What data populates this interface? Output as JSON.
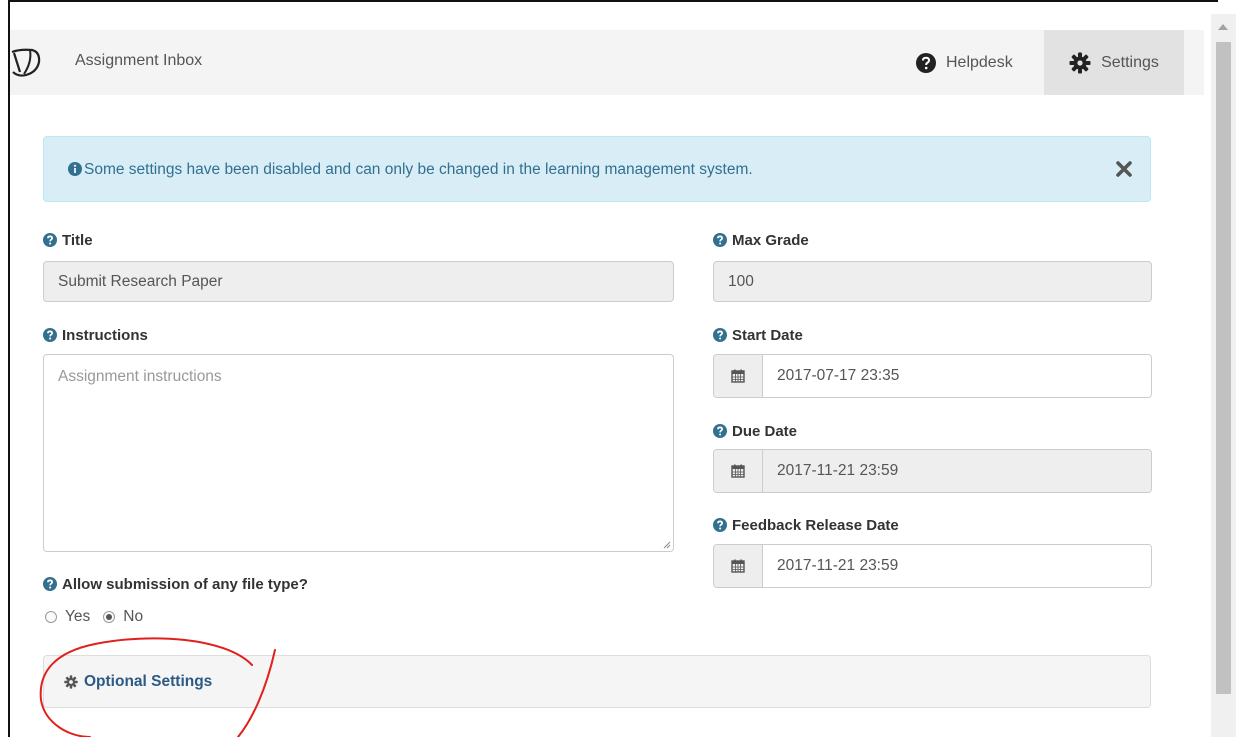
{
  "navbar": {
    "app_title": "Assignment Inbox",
    "helpdesk_label": "Helpdesk",
    "settings_label": "Settings"
  },
  "alert": {
    "message": "Some settings have been disabled and can only be changed in the learning management system."
  },
  "form": {
    "title_label": "Title",
    "title_value": "Submit Research Paper",
    "instructions_label": "Instructions",
    "instructions_placeholder": "Assignment instructions",
    "file_type_label": "Allow submission of any file type?",
    "file_type_options": [
      "Yes",
      "No"
    ],
    "file_type_selected": "No",
    "max_grade_label": "Max Grade",
    "max_grade_value": "100",
    "start_date_label": "Start Date",
    "start_date_value": "2017-07-17 23:35",
    "due_date_label": "Due Date",
    "due_date_value": "2017-11-21 23:59",
    "feedback_date_label": "Feedback Release Date",
    "feedback_date_value": "2017-11-21 23:59"
  },
  "optional_settings": {
    "label": "Optional Settings"
  },
  "icons": {
    "logo": "turnitin-logo-icon",
    "help": "question-circle-icon",
    "settings": "gear-icon",
    "info": "info-circle-icon",
    "close": "close-icon",
    "calendar": "calendar-icon"
  },
  "colors": {
    "alert_bg": "#d9edf7",
    "alert_text": "#31708f",
    "link": "#2b5a85",
    "annotation": "#e0201b"
  }
}
